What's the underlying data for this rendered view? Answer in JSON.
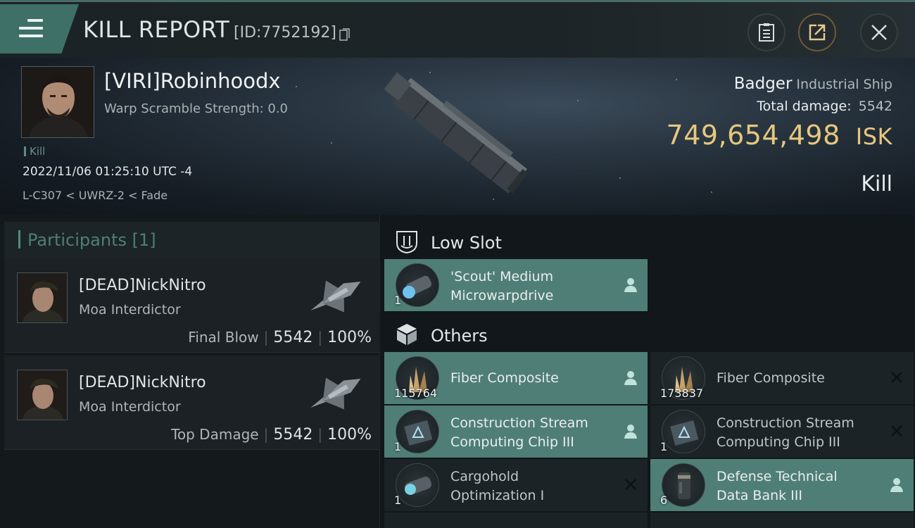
{
  "header": {
    "title": "KILL REPORT",
    "report_id": "[ID:7752192]"
  },
  "victim": {
    "name": "[VIRI]Robinhoodx",
    "warp_scramble": "Warp Scramble Strength: 0.0",
    "kill_tag": "Kill",
    "datetime": "2022/11/06 01:25:10 UTC -4",
    "location": "L-C307 < UWRZ-2 < Fade",
    "ship_name": "Badger",
    "ship_class": "Industrial Ship",
    "total_damage_label": "Total damage:",
    "total_damage": "5542",
    "isk_value": "749,654,498",
    "isk_unit": "ISK",
    "result": "Kill"
  },
  "participants": {
    "title": "Participants",
    "count": "[1]",
    "list": [
      {
        "name": "[DEAD]NickNitro",
        "ship": "Moa Interdictor",
        "role": "Final Blow",
        "damage": "5542",
        "percent": "100%"
      },
      {
        "name": "[DEAD]NickNitro",
        "ship": "Moa Interdictor",
        "role": "Top Damage",
        "damage": "5542",
        "percent": "100%"
      }
    ]
  },
  "sections": {
    "low_slot": "Low Slot",
    "others": "Others"
  },
  "items": {
    "low_slot": [
      {
        "name_line1": "'Scout' Medium",
        "name_line2": "Microwarpdrive",
        "qty": "1",
        "status": "dropped"
      }
    ],
    "others": [
      {
        "name_line1": "Fiber Composite",
        "name_line2": "",
        "qty": "115764",
        "status": "dropped"
      },
      {
        "name_line1": "Fiber Composite",
        "name_line2": "",
        "qty": "173837",
        "status": "destroyed"
      },
      {
        "name_line1": "Construction Stream",
        "name_line2": "Computing Chip III",
        "qty": "1",
        "status": "dropped"
      },
      {
        "name_line1": "Construction Stream",
        "name_line2": "Computing Chip III",
        "qty": "1",
        "status": "destroyed"
      },
      {
        "name_line1": "Cargohold",
        "name_line2": "Optimization I",
        "qty": "1",
        "status": "destroyed"
      },
      {
        "name_line1": "Defense Technical",
        "name_line2": "Data Bank III",
        "qty": "6",
        "status": "dropped"
      }
    ]
  },
  "colors": {
    "accent_teal": "#4f7e76",
    "isk_gold": "#e7c77e"
  }
}
